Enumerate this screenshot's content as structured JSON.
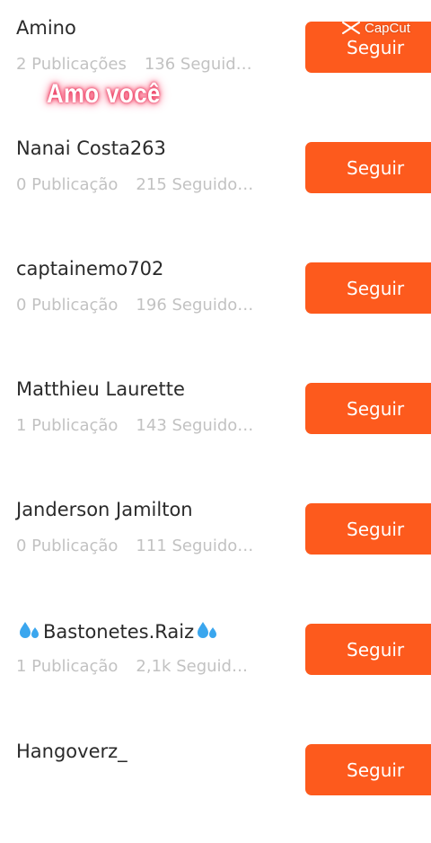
{
  "colors": {
    "accent": "#fd5a1d",
    "name": "#2a2a2a",
    "muted": "#c2c2c2"
  },
  "overlay_caption": "Amo você",
  "watermark": "CapCut",
  "users": [
    {
      "name": "Amino",
      "posts": "2 Publicações",
      "followers": "136 Seguid…",
      "button": "Seguir"
    },
    {
      "name": "Nanai Costa263",
      "posts": "0 Publicação",
      "followers": "215 Seguido…",
      "button": "Seguir"
    },
    {
      "name": "captainemo702",
      "posts": "0 Publicação",
      "followers": "196 Seguido…",
      "button": "Seguir"
    },
    {
      "name": "Matthieu Laurette",
      "posts": "1 Publicação",
      "followers": "143 Seguido…",
      "button": "Seguir"
    },
    {
      "name": "Janderson Jamilton",
      "posts": "0 Publicação",
      "followers": "111 Seguido…",
      "button": "Seguir"
    },
    {
      "name": "Bastonetes.Raiz",
      "posts": "1 Publicação",
      "followers": "2,1k Seguid…",
      "button": "Seguir"
    },
    {
      "name": "Hangoverz_",
      "posts": "",
      "followers": "",
      "button": "Seguir"
    }
  ]
}
